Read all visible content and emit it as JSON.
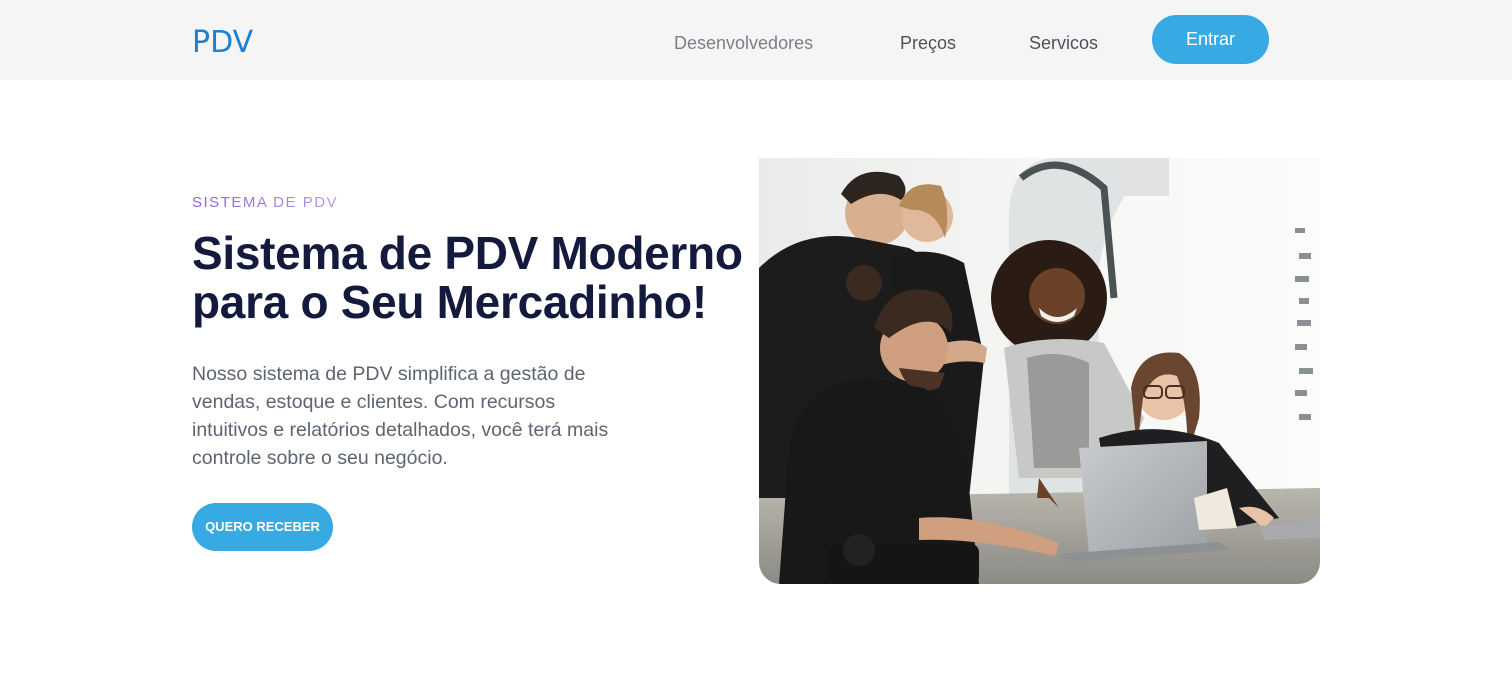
{
  "header": {
    "logo": "PDV",
    "nav": [
      "Desenvolvedores",
      "Preços",
      "Servicos"
    ],
    "login_label": "Entrar"
  },
  "hero": {
    "eyebrow": "SISTEMA DE PDV",
    "title_line1": "Sistema de PDV Moderno",
    "title_line2": "para o Seu Mercadinho!",
    "description": "Nosso sistema de PDV simplifica a gestão de vendas, estoque e clientes. Com recursos intuitivos e relatórios detalhados, você terá mais controle sobre o seu negócio.",
    "cta_label": "QUERO RECEBER",
    "image_alt": "team-working-photo"
  },
  "colors": {
    "brand_blue": "#1f7fd0",
    "button_blue": "#37a9e3",
    "headline_navy": "#141a3d",
    "eyebrow_purple": "#8a5ee0",
    "header_bg": "#f5f5f5"
  }
}
